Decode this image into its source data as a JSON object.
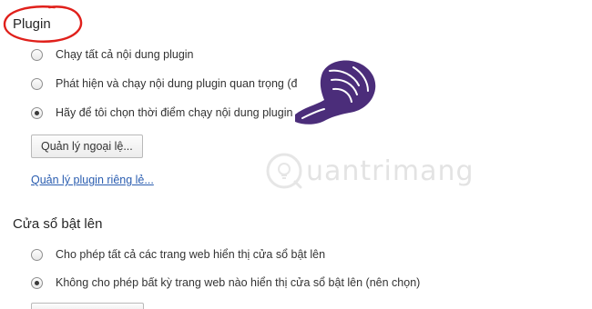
{
  "plugin_section": {
    "heading": "Plugin",
    "options": [
      {
        "label": "Chạy tất cả nội dung plugin",
        "checked": false
      },
      {
        "label": "Phát hiện và chạy nội dung plugin quan trọng (đề xuất)",
        "checked": false
      },
      {
        "label": "Hãy để tôi chọn thời điểm chạy nội dung plugin",
        "checked": true
      }
    ],
    "manage_exceptions_button": "Quản lý ngoại lệ...",
    "manage_plugins_link": "Quản lý plugin riêng lẻ..."
  },
  "popup_section": {
    "heading": "Cửa sổ bật lên",
    "options": [
      {
        "label": "Cho phép tất cả các trang web hiển thị cửa sổ bật lên",
        "checked": false
      },
      {
        "label": "Không cho phép bất kỳ trang web nào hiển thị cửa sổ bật lên (nên chọn)",
        "checked": true
      }
    ]
  },
  "watermark": "uantrimang",
  "colors": {
    "annotation": "#e0201b",
    "hand": "#4b2d7a",
    "link": "#2a5db0"
  }
}
